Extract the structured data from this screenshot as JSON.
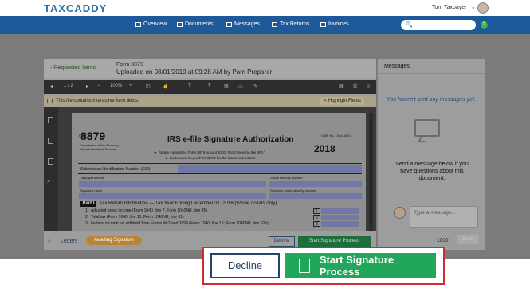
{
  "header": {
    "logo": "TAXCADDY",
    "user_name": "Tom Taxpayer",
    "caret": "⌄",
    "help": "?"
  },
  "nav": {
    "items": [
      {
        "label": "Overview",
        "icon": "home-icon"
      },
      {
        "label": "Documents",
        "icon": "documents-icon"
      },
      {
        "label": "Messages",
        "icon": "messages-icon"
      },
      {
        "label": "Tax Returns",
        "icon": "tax-returns-icon"
      },
      {
        "label": "Invoices",
        "icon": "invoices-icon"
      }
    ],
    "search_icon": "🔍"
  },
  "document": {
    "back_link": "Requested Items",
    "title": "Form 8879",
    "subtitle": "Uploaded on 03/01/2019 at 09:28 AM by Pam Preparer",
    "viewer": {
      "page": "1 / 2",
      "zoom": "100%"
    },
    "notice": "This file contains interactive form fields.",
    "highlight_fields": "Highlight Fields",
    "form": {
      "form_word": "Form",
      "number": "8879",
      "dept": "Department of the Treasury Internal Revenue Service",
      "title": "IRS e-file Signature Authorization",
      "line1": "► Return completed Form 8879 to your ERO. (Don't send to the IRS.)",
      "line2": "► Go to www.irs.gov/Form8879 for the latest information.",
      "omb": "OMB No. 1545-0074",
      "year": "2018",
      "sid_label": "Submission Identification Number (SID)",
      "taxpayer_name": "Taxpayer's name",
      "ssn": "Social security number",
      "spouse_name": "Spouse's name",
      "spouse_ssn": "Spouse's social security number",
      "part": "Part I",
      "part_title": "Tax Return Information — Tax Year Ending December 31, 2018 (Whole dollars only)",
      "rows": [
        {
          "num": "1",
          "text": "Adjusted gross income (Form 1040, line 7; Form 1040NR, line 35)",
          "box": "1"
        },
        {
          "num": "2",
          "text": "Total tax (Form 1040, line 15; Form 1040NR, line 61)",
          "box": "2"
        },
        {
          "num": "3",
          "text": "Federal income tax withheld from Forms W-2 and 1099 (Form 1040, line 16; Form 1040NR, line 62a) .",
          "box": "3"
        }
      ]
    },
    "footer": {
      "letters": "Letters",
      "status": "Awaiting Signature",
      "decline": "Decline",
      "start": "Start Signature Process"
    }
  },
  "messages": {
    "title": "Messages",
    "empty": "You haven't sent any messages yet.",
    "help": "Send a message below if you have questions about this document.",
    "placeholder": "Type a message...",
    "char_count": "1000",
    "send": "Send"
  },
  "actions": {
    "decline": "Decline",
    "start": "Start Signature Process"
  },
  "colors": {
    "nav": "#1e5a99",
    "primary_green": "#22a65a",
    "decline_border": "#24466b",
    "highlight_border": "#d12a31"
  }
}
